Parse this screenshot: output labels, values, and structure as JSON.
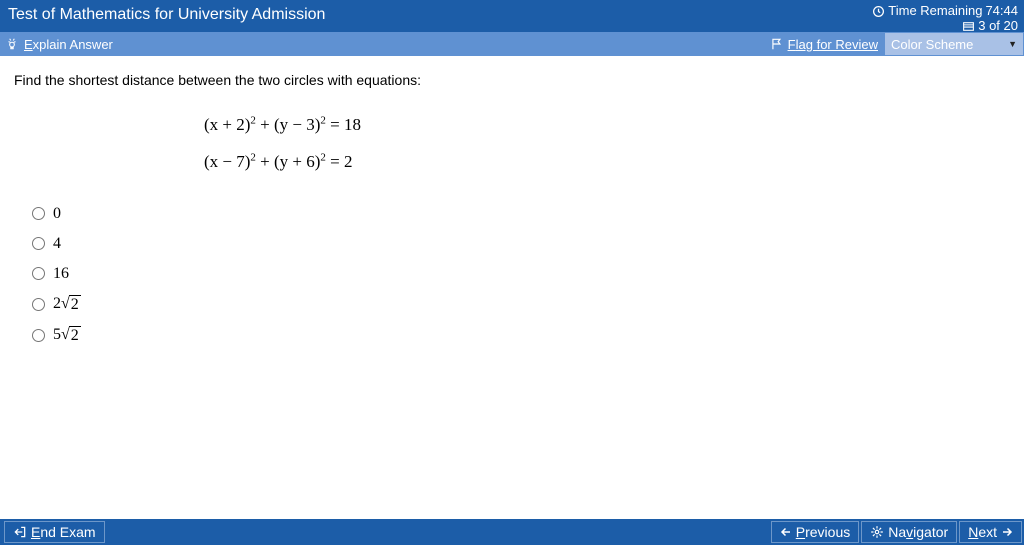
{
  "header": {
    "title": "Test of Mathematics for University Admission",
    "time_label": "Time Remaining",
    "time_value": "74:44",
    "progress": "3 of 20"
  },
  "subbar": {
    "explain": "Explain Answer",
    "flag": "Flag for Review",
    "scheme_label": "Color Scheme"
  },
  "question": {
    "prompt": "Find the shortest distance between the two circles with equations:",
    "eq1_a": "(x + 2)",
    "eq1_b": " + (y − 3)",
    "eq1_c": " = 18",
    "eq2_a": "(x − 7)",
    "eq2_b": " + (y + 6)",
    "eq2_c": " = 2",
    "choices": {
      "a": "0",
      "b": "4",
      "c": "16",
      "d_coef": "2",
      "d_rad": "2",
      "e_coef": "5",
      "e_rad": "2"
    }
  },
  "footer": {
    "end": "End Exam",
    "prev": "Previous",
    "nav": "Navigator",
    "next": "Next"
  }
}
